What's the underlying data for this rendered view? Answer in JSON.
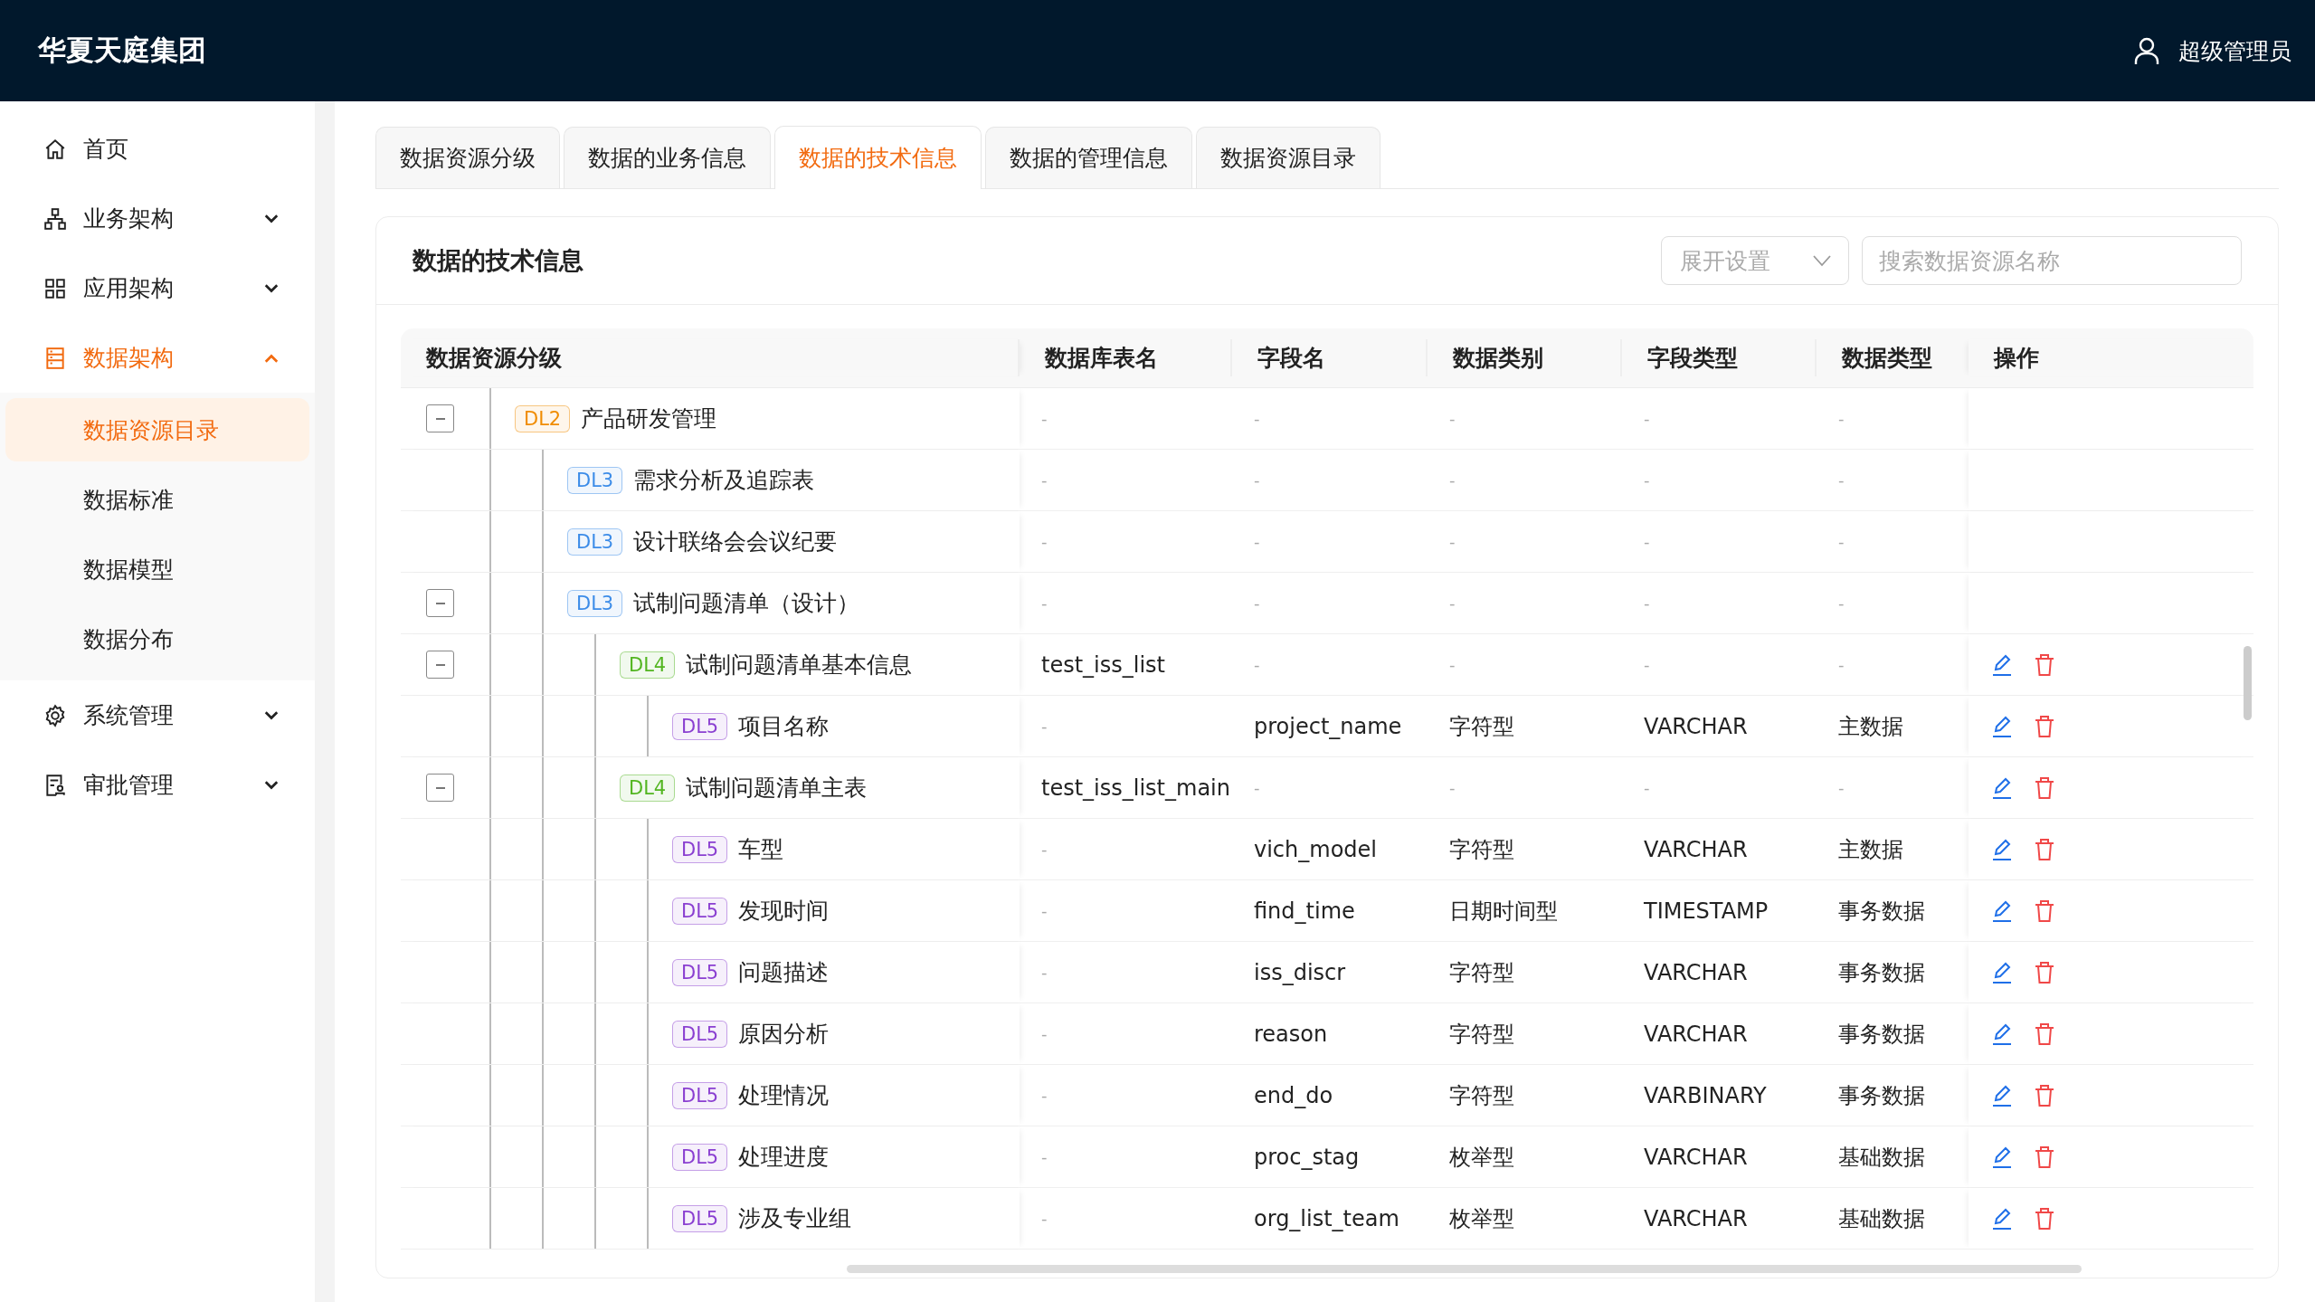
{
  "header": {
    "logo": "华夏天庭集团",
    "user": "超级管理员"
  },
  "sidebar": {
    "items": [
      {
        "kind": "home",
        "label": "首页",
        "selected": false
      },
      {
        "kind": "org",
        "label": "业务架构",
        "selected": false,
        "expanded": false
      },
      {
        "kind": "grid",
        "label": "应用架构",
        "selected": false,
        "expanded": false
      },
      {
        "kind": "database",
        "label": "数据架构",
        "selected": true,
        "expanded": true,
        "children": [
          {
            "label": "数据资源目录",
            "selected": true
          },
          {
            "label": "数据标准",
            "selected": false
          },
          {
            "label": "数据模型",
            "selected": false
          },
          {
            "label": "数据分布",
            "selected": false
          }
        ]
      },
      {
        "kind": "gear",
        "label": "系统管理",
        "selected": false,
        "expanded": false
      },
      {
        "kind": "approval",
        "label": "审批管理",
        "selected": false,
        "expanded": false
      }
    ]
  },
  "tabs": [
    {
      "label": "数据资源分级",
      "selected": false
    },
    {
      "label": "数据的业务信息",
      "selected": false
    },
    {
      "label": "数据的技术信息",
      "selected": true
    },
    {
      "label": "数据的管理信息",
      "selected": false
    },
    {
      "label": "数据资源目录",
      "selected": false
    }
  ],
  "panel": {
    "title": "数据的技术信息",
    "expand_select": {
      "placeholder": "展开设置"
    },
    "search": {
      "placeholder": "搜索数据资源名称"
    }
  },
  "table": {
    "columns": [
      "数据资源分级",
      "数据库表名",
      "字段名",
      "数据类别",
      "字段类型",
      "数据类型",
      "操作"
    ],
    "rows": [
      {
        "level": "DL2",
        "color": "#f08c00",
        "name": "产品研发管理",
        "table_name": "-",
        "field_name": "-",
        "data_category": "-",
        "field_type": "-",
        "data_type": "-",
        "editable": false,
        "expanded": true,
        "children": [
          {
            "level": "DL3",
            "color": "#3c8ce8",
            "name": "需求分析及追踪表",
            "table_name": "-",
            "field_name": "-",
            "data_category": "-",
            "field_type": "-",
            "data_type": "-",
            "editable": false
          },
          {
            "level": "DL3",
            "color": "#3c8ce8",
            "name": "设计联络会会议纪要",
            "table_name": "-",
            "field_name": "-",
            "data_category": "-",
            "field_type": "-",
            "data_type": "-",
            "editable": false
          },
          {
            "level": "DL3",
            "color": "#3c8ce8",
            "name": "试制问题清单（设计）",
            "table_name": "-",
            "field_name": "-",
            "data_category": "-",
            "field_type": "-",
            "data_type": "-",
            "editable": false,
            "expanded": true,
            "children": [
              {
                "level": "DL4",
                "color": "#52b520",
                "name": "试制问题清单基本信息",
                "table_name": "test_iss_list",
                "field_name": "-",
                "data_category": "-",
                "field_type": "-",
                "data_type": "-",
                "editable": true,
                "expanded": true,
                "children": [
                  {
                    "level": "DL5",
                    "color": "#8a3fd1",
                    "name": "项目名称",
                    "table_name": "-",
                    "field_name": "project_name",
                    "data_category": "字符型",
                    "field_type": "VARCHAR",
                    "data_type": "主数据",
                    "editable": true
                  }
                ]
              },
              {
                "level": "DL4",
                "color": "#52b520",
                "name": "试制问题清单主表",
                "table_name": "test_iss_list_main",
                "field_name": "-",
                "data_category": "-",
                "field_type": "-",
                "data_type": "-",
                "editable": true,
                "expanded": true,
                "children": [
                  {
                    "level": "DL5",
                    "color": "#8a3fd1",
                    "name": "车型",
                    "table_name": "-",
                    "field_name": "vich_model",
                    "data_category": "字符型",
                    "field_type": "VARCHAR",
                    "data_type": "主数据",
                    "editable": true
                  },
                  {
                    "level": "DL5",
                    "color": "#8a3fd1",
                    "name": "发现时间",
                    "table_name": "-",
                    "field_name": "find_time",
                    "data_category": "日期时间型",
                    "field_type": "TIMESTAMP",
                    "data_type": "事务数据",
                    "editable": true
                  },
                  {
                    "level": "DL5",
                    "color": "#8a3fd1",
                    "name": "问题描述",
                    "table_name": "-",
                    "field_name": "iss_discr",
                    "data_category": "字符型",
                    "field_type": "VARCHAR",
                    "data_type": "事务数据",
                    "editable": true
                  },
                  {
                    "level": "DL5",
                    "color": "#8a3fd1",
                    "name": "原因分析",
                    "table_name": "-",
                    "field_name": "reason",
                    "data_category": "字符型",
                    "field_type": "VARCHAR",
                    "data_type": "事务数据",
                    "editable": true
                  },
                  {
                    "level": "DL5",
                    "color": "#8a3fd1",
                    "name": "处理情况",
                    "table_name": "-",
                    "field_name": "end_do",
                    "data_category": "字符型",
                    "field_type": "VARBINARY",
                    "data_type": "事务数据",
                    "editable": true
                  },
                  {
                    "level": "DL5",
                    "color": "#8a3fd1",
                    "name": "处理进度",
                    "table_name": "-",
                    "field_name": "proc_stag",
                    "data_category": "枚举型",
                    "field_type": "VARCHAR",
                    "data_type": "基础数据",
                    "editable": true
                  },
                  {
                    "level": "DL5",
                    "color": "#8a3fd1",
                    "name": "涉及专业组",
                    "table_name": "-",
                    "field_name": "org_list_team",
                    "data_category": "枚举型",
                    "field_type": "VARCHAR",
                    "data_type": "基础数据",
                    "editable": true
                  }
                ]
              }
            ]
          }
        ]
      }
    ]
  }
}
